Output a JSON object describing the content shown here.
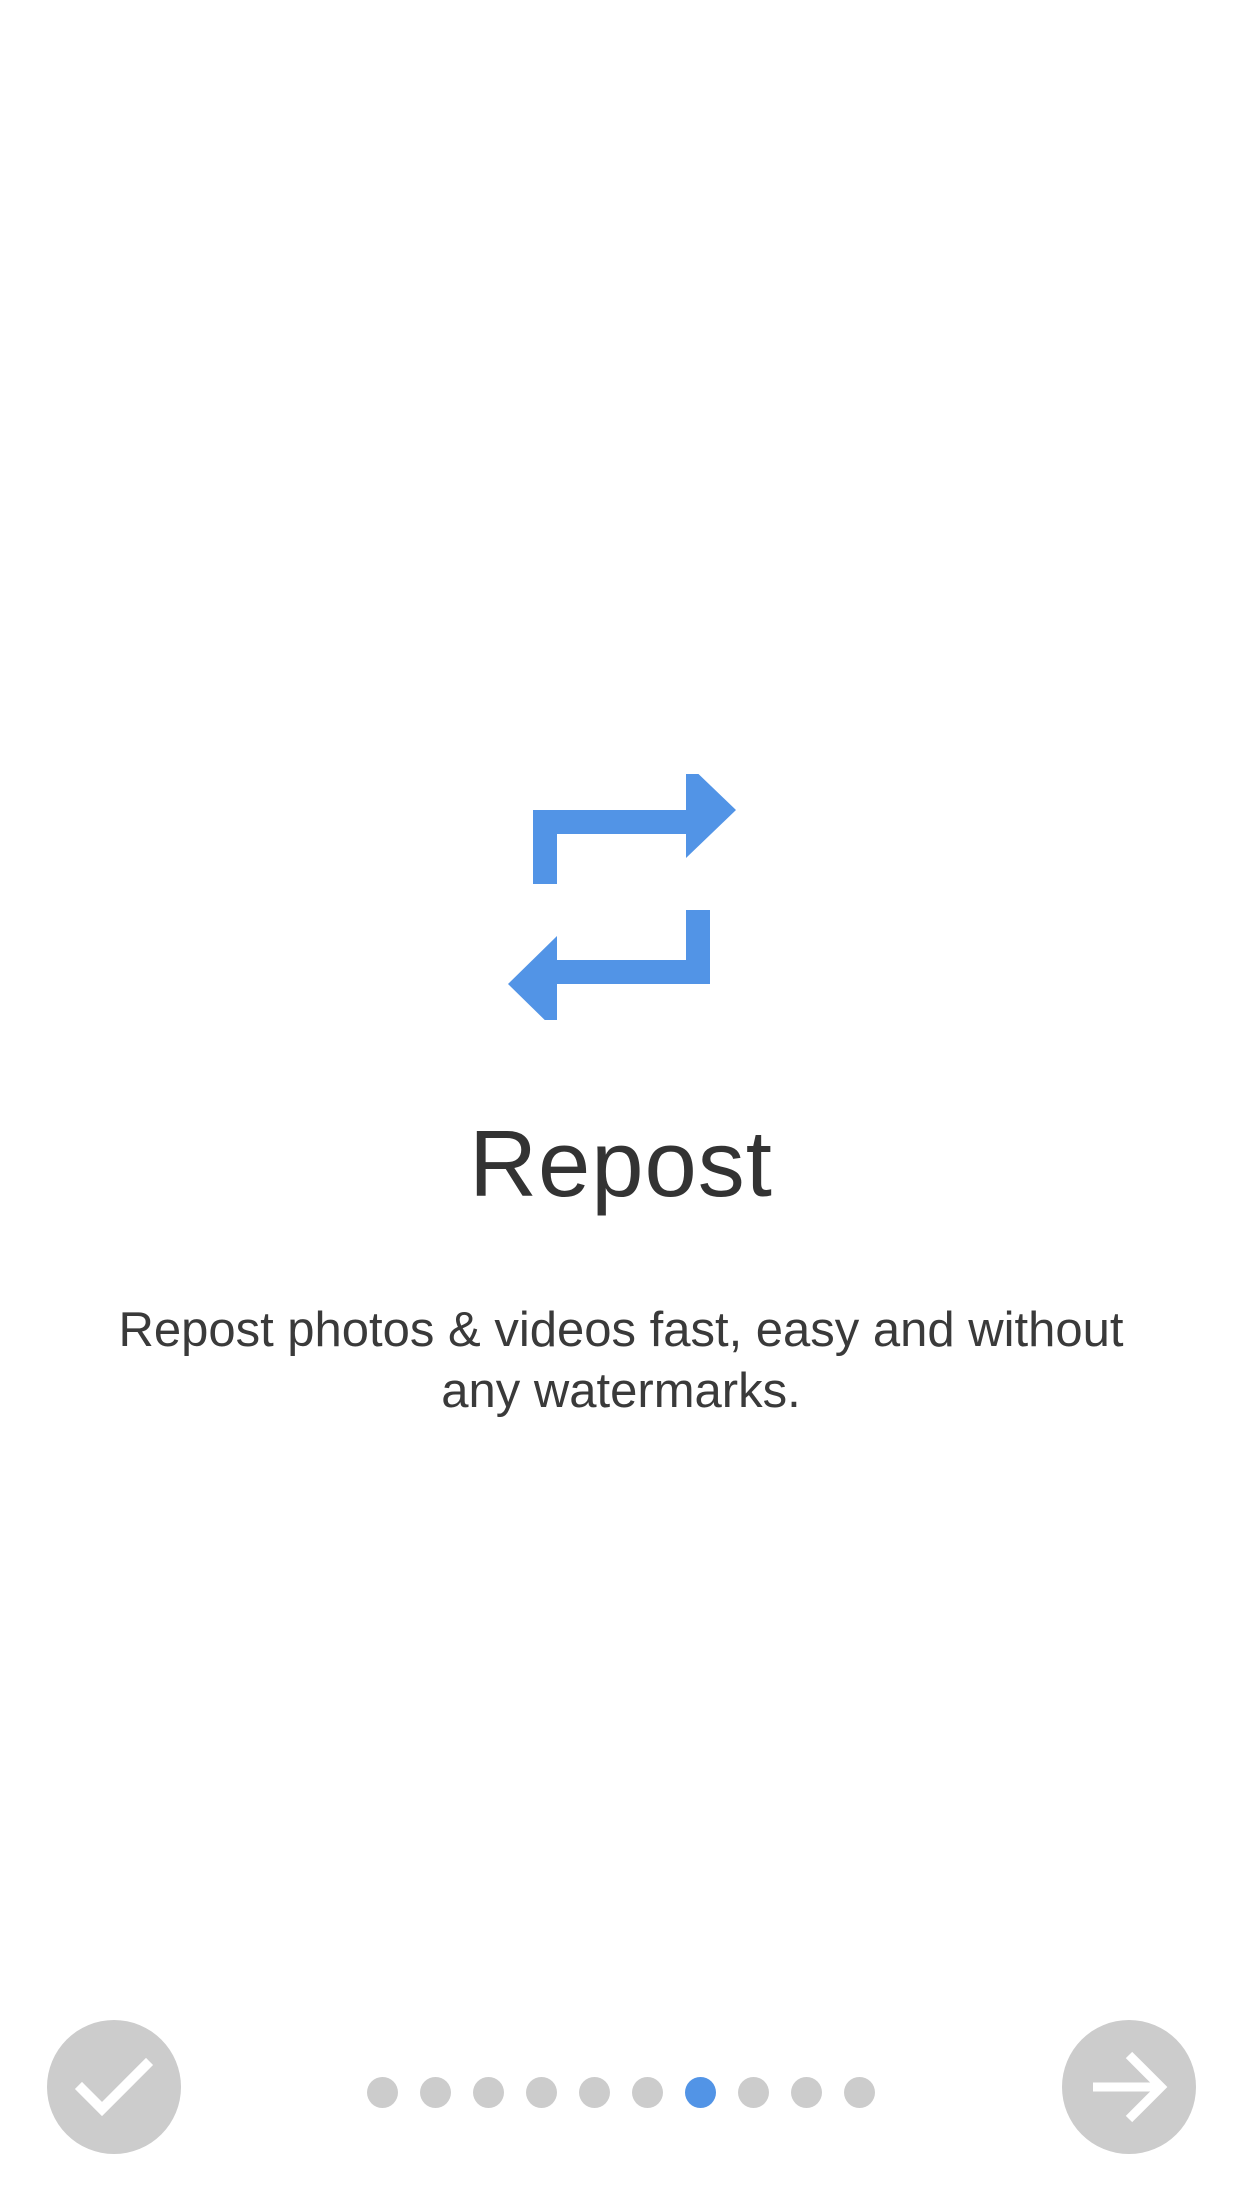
{
  "onboarding": {
    "title": "Repost",
    "description": "Repost photos & videos fast, easy and without any watermarks.",
    "hero_icon": "repost-arrows-icon",
    "accent_color": "#5294e6"
  },
  "pager": {
    "total_pages": 10,
    "current_page": 7,
    "inactive_color": "#cccccc",
    "active_color": "#5294e6"
  },
  "controls": {
    "done_icon": "checkmark-icon",
    "next_icon": "arrow-right-icon",
    "button_color": "#cccccc"
  }
}
